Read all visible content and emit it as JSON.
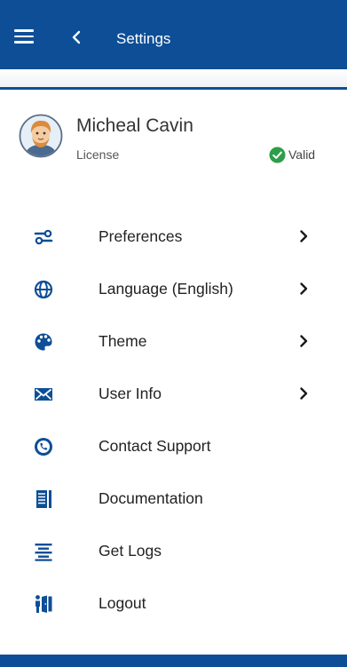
{
  "header": {
    "title": "Settings",
    "menu_icon": "hamburger-menu-icon",
    "back_icon": "chevron-left-icon",
    "bg_color": "#0d4e96"
  },
  "profile": {
    "name": "Micheal Cavin",
    "license_label": "License",
    "license_status": "Valid",
    "status_color": "#2e9e4a",
    "avatar_icon": "user-avatar-icon"
  },
  "menu": {
    "items": [
      {
        "label": "Preferences",
        "icon": "sliders-icon",
        "has_chevron": true
      },
      {
        "label": "Language (English)",
        "icon": "globe-icon",
        "has_chevron": true
      },
      {
        "label": "Theme",
        "icon": "palette-icon",
        "has_chevron": true
      },
      {
        "label": "User Info",
        "icon": "envelope-icon",
        "has_chevron": true
      },
      {
        "label": "Contact Support",
        "icon": "support-phone-icon",
        "has_chevron": false
      },
      {
        "label": "Documentation",
        "icon": "document-icon",
        "has_chevron": false
      },
      {
        "label": "Get Logs",
        "icon": "logs-icon",
        "has_chevron": false
      },
      {
        "label": "Logout",
        "icon": "logout-icon",
        "has_chevron": false
      }
    ]
  },
  "colors": {
    "icon": "#0d4e96",
    "accent": "#0d4e96"
  }
}
